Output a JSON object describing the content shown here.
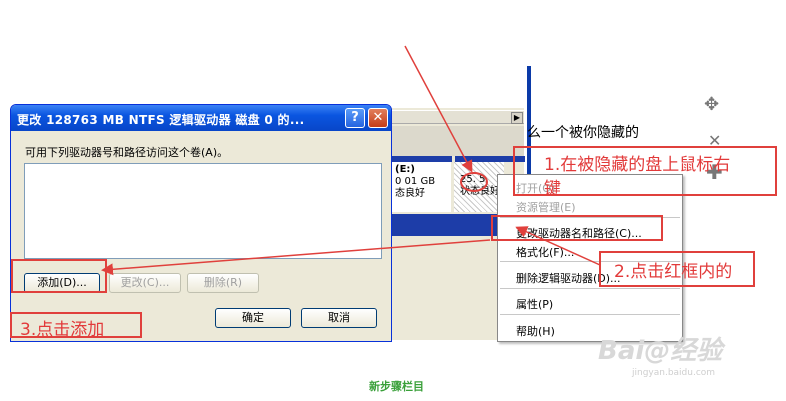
{
  "background": {
    "snippet": "么一个被你隐藏的",
    "footer_text": "新步骤栏目",
    "watermark": "Bai@经验",
    "watermark_url": "jingyan.baidu.com"
  },
  "disk_view": {
    "vol1": {
      "line1": "(E:)",
      "line2": "0 01 GB",
      "line3": "态良好"
    },
    "vol2": {
      "line1": "25. 5",
      "line2": "状态良好"
    }
  },
  "dialog": {
    "title": "更改 128763 MB NTFS 逻辑驱动器 磁盘 0 的...",
    "help_label": "?",
    "close_label": "✕",
    "label": "可用下列驱动器号和路径访问这个卷(A)。",
    "buttons": {
      "add": "添加(D)...",
      "change": "更改(C)...",
      "delete": "删除(R)",
      "ok": "确定",
      "cancel": "取消"
    }
  },
  "context_menu": {
    "items": [
      {
        "label": "打开(O)",
        "enabled": false
      },
      {
        "label": "资源管理(E)",
        "enabled": false
      },
      {
        "label": "更改驱动器名和路径(C)...",
        "enabled": true
      },
      {
        "label": "格式化(F)...",
        "enabled": true
      },
      {
        "label": "删除逻辑驱动器(D)...",
        "enabled": true
      },
      {
        "label": "属性(P)",
        "enabled": true
      },
      {
        "label": "帮助(H)",
        "enabled": true
      }
    ]
  },
  "annotations": {
    "step1_line1": "1.在被隐藏的盘上鼠标右",
    "step1_line2": "键",
    "step2": "2.点击红框内的",
    "step3": "3.点击添加"
  },
  "colors": {
    "annotation_red": "#e0403c",
    "xp_title_blue": "#0a55e0"
  },
  "icons": [
    "move-icon",
    "close-icon",
    "plus-icon",
    "help-icon"
  ]
}
